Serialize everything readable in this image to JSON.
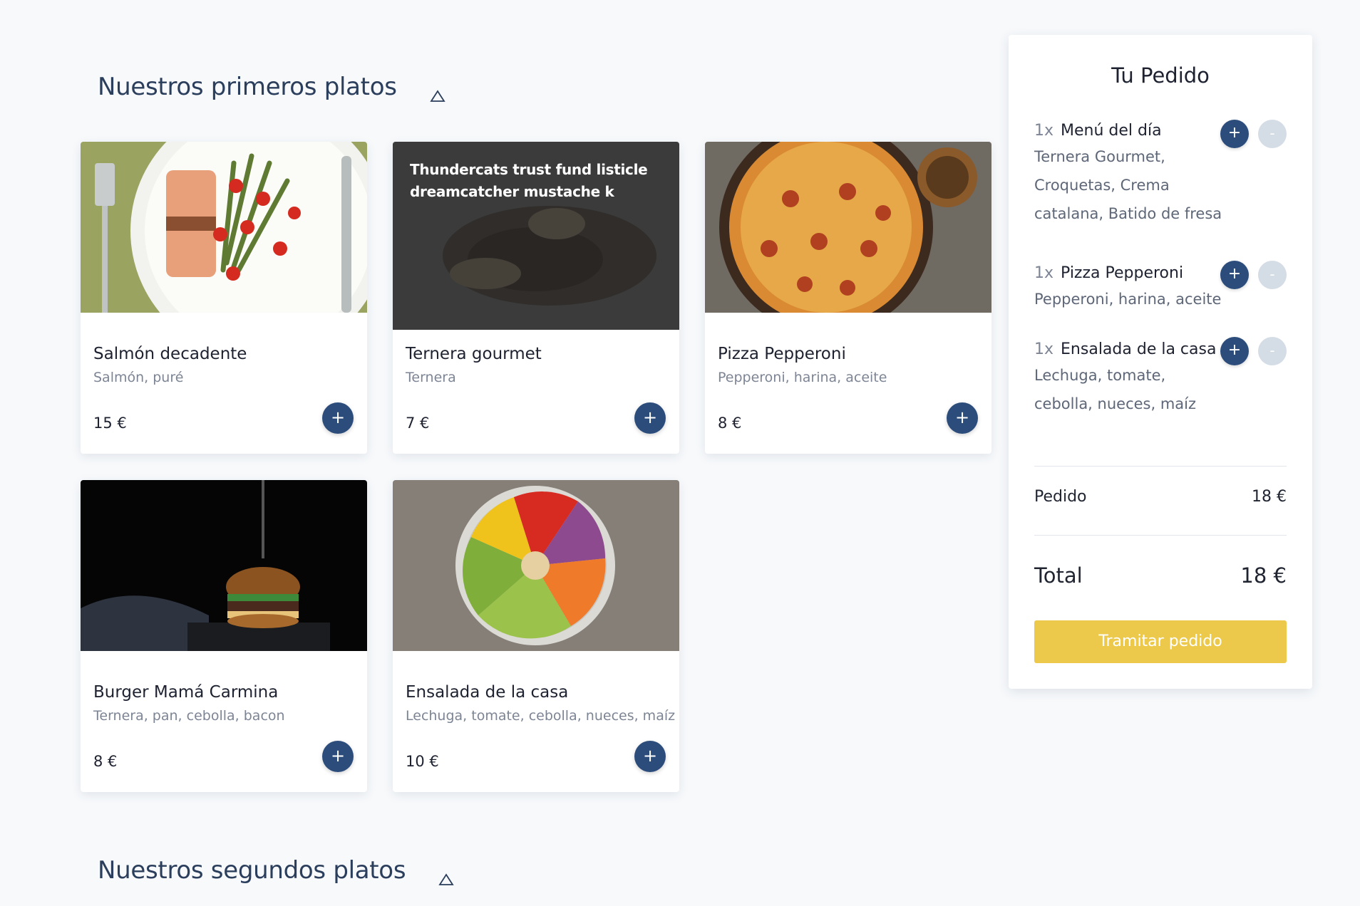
{
  "sections": {
    "first": {
      "title": "Nuestros primeros platos",
      "toggle_icon": "triangle-up-icon"
    },
    "second": {
      "title": "Nuestros segundos platos",
      "toggle_icon": "triangle-up-icon"
    }
  },
  "dishes": [
    {
      "name": "Salmón decadente",
      "desc": "Salmón, puré",
      "price": "15 €",
      "add": "+"
    },
    {
      "name": "Ternera gourmet",
      "desc": "Ternera",
      "price": "7 €",
      "add": "+",
      "overlay": "Thundercats trust fund listicle dreamcatcher mustache k"
    },
    {
      "name": "Pizza Pepperoni",
      "desc": "Pepperoni, harina, aceite",
      "price": "8 €",
      "add": "+"
    },
    {
      "name": "Burger Mamá Carmina",
      "desc": "Ternera, pan, cebolla, bacon",
      "price": "8 €",
      "add": "+"
    },
    {
      "name": "Ensalada de la casa",
      "desc": "Lechuga, tomate, cebolla, nueces, maíz",
      "price": "10 €",
      "add": "+"
    }
  ],
  "order": {
    "title": "Tu Pedido",
    "items": [
      {
        "qty": "1x",
        "name": "Menú del día",
        "ingredients": "Ternera Gourmet, Croquetas, Crema catalana, Batido de fresa",
        "plus": "+",
        "minus": "-"
      },
      {
        "qty": "1x",
        "name": "Pizza Pepperoni",
        "ingredients": "Pepperoni, harina, aceite",
        "plus": "+",
        "minus": "-"
      },
      {
        "qty": "1x",
        "name": "Ensalada de la casa",
        "ingredients": "Lechuga, tomate, cebolla, nueces, maíz",
        "plus": "+",
        "minus": "-"
      }
    ],
    "subtotal_label": "Pedido",
    "subtotal_value": "18 €",
    "total_label": "Total",
    "total_value": "18 €",
    "checkout_label": "Tramitar pedido"
  },
  "colors": {
    "primary": "#2c4d7c",
    "accent": "#ecc94b",
    "background": "#f7f9fb",
    "muted_button": "#d4dce6"
  }
}
